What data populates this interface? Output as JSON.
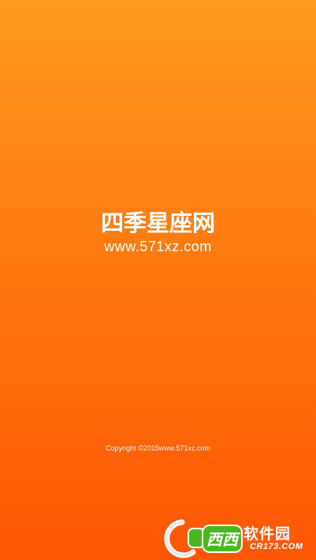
{
  "splash": {
    "app_name": "四季星座网",
    "url": "www.571xz.com",
    "copyright": "Copyright ©2015www.571xz.com",
    "background_colors": [
      "#ff9a1f",
      "#ff5606"
    ]
  },
  "watermark": {
    "icon": "c-logo-icon",
    "mark": "西西",
    "name": "软件园",
    "domain": "CR173.COM"
  }
}
